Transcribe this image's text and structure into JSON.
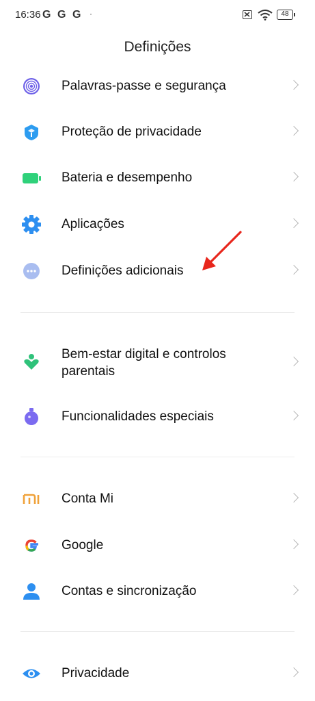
{
  "status_bar": {
    "time": "16:36",
    "notifications": [
      "G",
      "G",
      "G"
    ],
    "dot": "·",
    "battery": "48"
  },
  "page": {
    "title": "Definições"
  },
  "groups": [
    {
      "items": [
        {
          "label": "Palavras-passe e segurança",
          "icon": "fingerprint-icon",
          "color": "#6f62e8"
        },
        {
          "label": "Proteção de privacidade",
          "icon": "shield-icon",
          "color": "#2d9cf0"
        },
        {
          "label": "Bateria e desempenho",
          "icon": "battery-icon",
          "color": "#2fd17a"
        },
        {
          "label": "Aplicações",
          "icon": "gear-icon",
          "color": "#2d8ff0"
        },
        {
          "label": "Definições adicionais",
          "icon": "more-dots-icon",
          "color": "#9fb3ec"
        }
      ]
    },
    {
      "items": [
        {
          "label": "Bem-estar digital e controlos parentais",
          "icon": "wellbeing-icon",
          "color": "#2fc27a"
        },
        {
          "label": "Funcionalidades especiais",
          "icon": "flask-icon",
          "color": "#7b6bf0"
        }
      ]
    },
    {
      "items": [
        {
          "label": "Conta Mi",
          "icon": "mi-logo-icon",
          "color": "#f0a23a"
        },
        {
          "label": "Google",
          "icon": "google-icon",
          "color": "#4285f4"
        },
        {
          "label": "Contas e sincronização",
          "icon": "user-icon",
          "color": "#2d8ff0"
        }
      ]
    },
    {
      "items": [
        {
          "label": "Privacidade",
          "icon": "eye-icon",
          "color": "#2d8ff0"
        }
      ]
    }
  ],
  "annotation": {
    "color": "#e8261c"
  }
}
